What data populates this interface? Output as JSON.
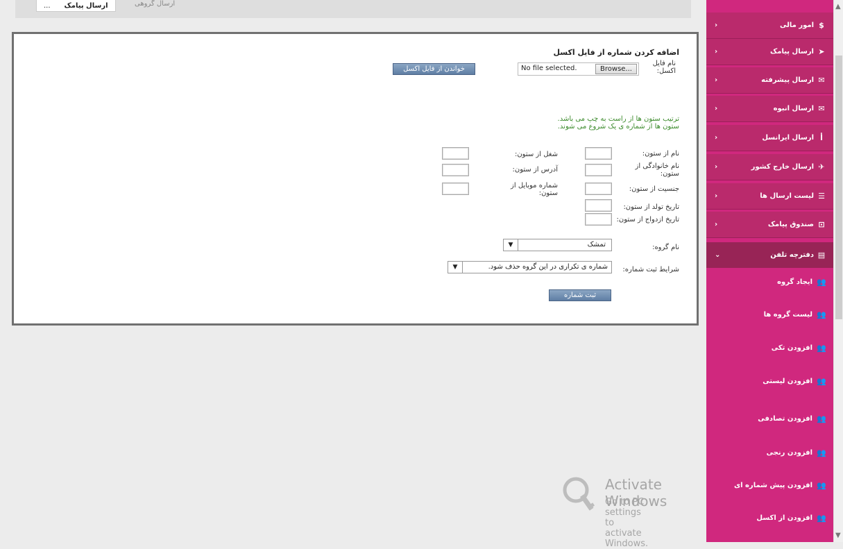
{
  "breadcrumb": {
    "tab1": "ارسال پیامک",
    "tab2": "...",
    "path": "ارسال گروهی"
  },
  "form": {
    "title": "اضافه کردن شماره از فایل اکسل",
    "file_label": "نام فایل اکسل:",
    "browse_label": "Browse...",
    "file_status": "No file selected.",
    "read_button": "خواندن از فایل اکسل",
    "note_line1": "ترتیب ستون ها از راست به چپ می باشد.",
    "note_line2": "ستون ها از شماره ی یک شروع می شوند.",
    "right_fields": [
      "نام از ستون:",
      "نام خانوادگی از ستون:",
      "جنسیت از ستون:",
      "تاریخ تولد از ستون:",
      "تاریخ ازدواج از ستون:"
    ],
    "left_fields": [
      "شغل از ستون:",
      "آدرس از ستون:",
      "شماره موبایل از ستون:"
    ],
    "group_label": "نام گروه:",
    "group_value": "تمشک",
    "condition_label": "شرایط ثبت شماره:",
    "condition_value": "شماره ی تکراری در این گروه حذف شود.",
    "submit_button": "ثبت شماره"
  },
  "sidebar": {
    "main_items": [
      {
        "label": "امور مالی",
        "icon": "dollar-icon"
      },
      {
        "label": "ارسال پیامک",
        "icon": "send-icon"
      },
      {
        "label": "ارسال پیشرفته",
        "icon": "envelope-icon"
      },
      {
        "label": "ارسال انبوه",
        "icon": "envelope-outline-icon"
      },
      {
        "label": "ارسال ایرانسل",
        "icon": "irancell-icon"
      },
      {
        "label": "ارسال خارج کشور",
        "icon": "plane-icon"
      },
      {
        "label": "لیست ارسال ها",
        "icon": "list-icon"
      },
      {
        "label": "صندوق پیامک",
        "icon": "inbox-icon"
      }
    ],
    "active_item": {
      "label": "دفترچه تلفن",
      "icon": "book-icon"
    },
    "sub_items": [
      "ایجاد گروه",
      "لیست گروه ها",
      "افزودن تکی",
      "افزودن لیستی",
      "افزودن تصادفی",
      "افزودن رنجی",
      "افزودن پیش شماره ای",
      "افزودن از اکسل"
    ]
  },
  "watermark": {
    "title": "Activate Windows",
    "subtitle": "Go to PC settings to activate Windows."
  }
}
